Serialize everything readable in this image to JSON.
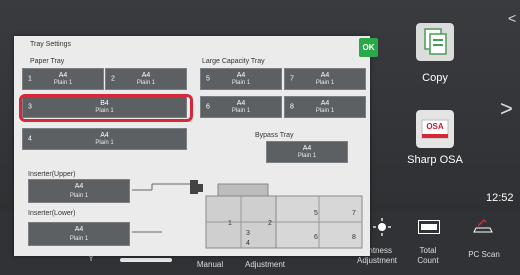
{
  "dialog": {
    "title": "Tray Settings",
    "ok_label": "OK",
    "paper_tray_label": "Paper Tray",
    "large_capacity_label": "Large Capacity Tray",
    "bypass_label": "Bypass Tray",
    "inserter_upper_label": "Inserter(Upper)",
    "inserter_lower_label": "Inserter(Lower)",
    "trays": {
      "t1": {
        "num": "1",
        "size": "A4",
        "type": "Plain 1"
      },
      "t2": {
        "num": "2",
        "size": "A4",
        "type": "Plain 1"
      },
      "t3": {
        "num": "3",
        "size": "B4",
        "type": "Plain 1"
      },
      "t4": {
        "num": "4",
        "size": "A4",
        "type": "Plain 1"
      },
      "t5": {
        "num": "5",
        "size": "A4",
        "type": "Plain 1"
      },
      "t6": {
        "num": "6",
        "size": "A4",
        "type": "Plain 1"
      },
      "t7": {
        "num": "7",
        "size": "A4",
        "type": "Plain 1"
      },
      "t8": {
        "num": "8",
        "size": "A4",
        "type": "Plain 1"
      },
      "bypass": {
        "size": "A4",
        "type": "Plain 1"
      },
      "inserter_upper": {
        "size": "A4",
        "type": "Plain 1"
      },
      "inserter_lower": {
        "size": "A4",
        "type": "Plain 1"
      }
    },
    "machine_labels": [
      "1",
      "2",
      "3",
      "4",
      "5",
      "6",
      "7",
      "8"
    ]
  },
  "home": {
    "copy_label": "Copy",
    "sharp_osa_label": "Sharp OSA",
    "osa_icon_text": "OSA",
    "clock": "12:52",
    "top_arrow": "<",
    "next_arrow": ">"
  },
  "bottom_bar": {
    "y_label": "Y",
    "manual_label": "Manual",
    "adjustment_label": "Adjustment",
    "brightness_label_1": "htness",
    "brightness_label_2": "Adjustment",
    "total_count_label_1": "Total",
    "total_count_label_2": "Count",
    "pc_scan_label": "PC Scan",
    "progress_fraction": 0.5
  },
  "colors": {
    "ok": "#2ba84a",
    "highlight": "#d62839",
    "tray": "#5d6063"
  }
}
